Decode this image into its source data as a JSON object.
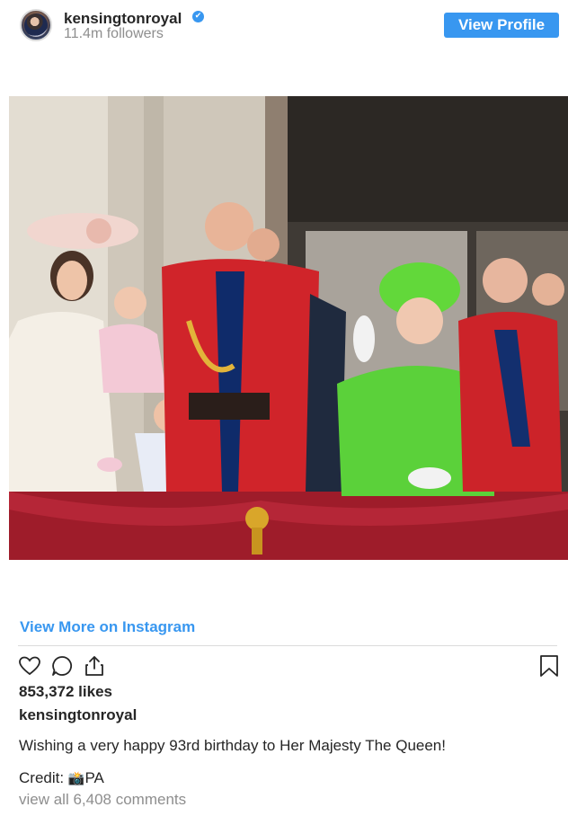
{
  "header": {
    "username": "kensingtonroyal",
    "verified_mark": "✔",
    "followers": "11.4m followers",
    "view_profile_label": "View Profile",
    "accent_color": "#3897f0"
  },
  "post": {
    "photo_icon": "photo-royal-family-balcony",
    "view_more_label": "View More on Instagram",
    "actions": {
      "like_icon": "heart-icon",
      "comment_icon": "comment-icon",
      "share_icon": "share-icon",
      "save_icon": "bookmark-icon"
    },
    "likes": "853,372 likes",
    "owner": "kensingtonroyal",
    "caption": "Wishing a very happy 93rd birthday to Her Majesty The Queen!",
    "credit_label": "Credit: ",
    "credit_icon": "📸",
    "credit_source": "PA",
    "comments_link": "view all 6,408 comments"
  }
}
